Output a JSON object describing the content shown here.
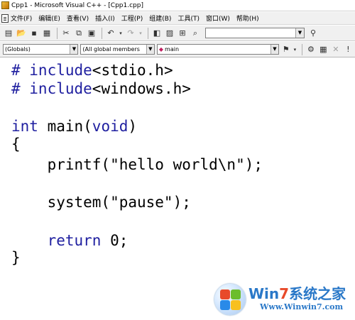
{
  "window": {
    "title": "Cpp1 - Microsoft Visual C++ - [Cpp1.cpp]"
  },
  "menubar": {
    "items": [
      {
        "label": "文件(F)"
      },
      {
        "label": "编辑(E)"
      },
      {
        "label": "查看(V)"
      },
      {
        "label": "插入(I)"
      },
      {
        "label": "工程(P)"
      },
      {
        "label": "组建(B)"
      },
      {
        "label": "工具(T)"
      },
      {
        "label": "窗口(W)"
      },
      {
        "label": "帮助(H)"
      }
    ]
  },
  "toolbar1": {
    "find_combo_value": ""
  },
  "toolbar2": {
    "scope_combo": "(Globals)",
    "members_combo": "(All global members",
    "function_combo": "main"
  },
  "code": {
    "lines": [
      {
        "tokens": [
          {
            "t": "pp",
            "v": "# include"
          },
          {
            "t": "tx",
            "v": "<stdio.h>"
          }
        ]
      },
      {
        "tokens": [
          {
            "t": "pp",
            "v": "# include"
          },
          {
            "t": "tx",
            "v": "<windows.h>"
          }
        ]
      },
      {
        "tokens": []
      },
      {
        "tokens": [
          {
            "t": "kw",
            "v": "int"
          },
          {
            "t": "tx",
            "v": " main("
          },
          {
            "t": "kw",
            "v": "void"
          },
          {
            "t": "tx",
            "v": ")"
          }
        ]
      },
      {
        "tokens": [
          {
            "t": "tx",
            "v": "{"
          }
        ]
      },
      {
        "tokens": [
          {
            "t": "tx",
            "v": "    printf(\"hello world\\n\");"
          }
        ]
      },
      {
        "tokens": []
      },
      {
        "tokens": [
          {
            "t": "tx",
            "v": "    system(\"pause\");"
          }
        ]
      },
      {
        "tokens": []
      },
      {
        "tokens": [
          {
            "t": "tx",
            "v": "    "
          },
          {
            "t": "kw",
            "v": "return"
          },
          {
            "t": "tx",
            "v": " 0;"
          }
        ]
      },
      {
        "tokens": [
          {
            "t": "tx",
            "v": "}"
          }
        ]
      }
    ]
  },
  "watermark": {
    "brand_part1": "Win",
    "brand_seven": "7",
    "brand_cn": "系统之家",
    "url": "Www.Winwin7.com"
  }
}
